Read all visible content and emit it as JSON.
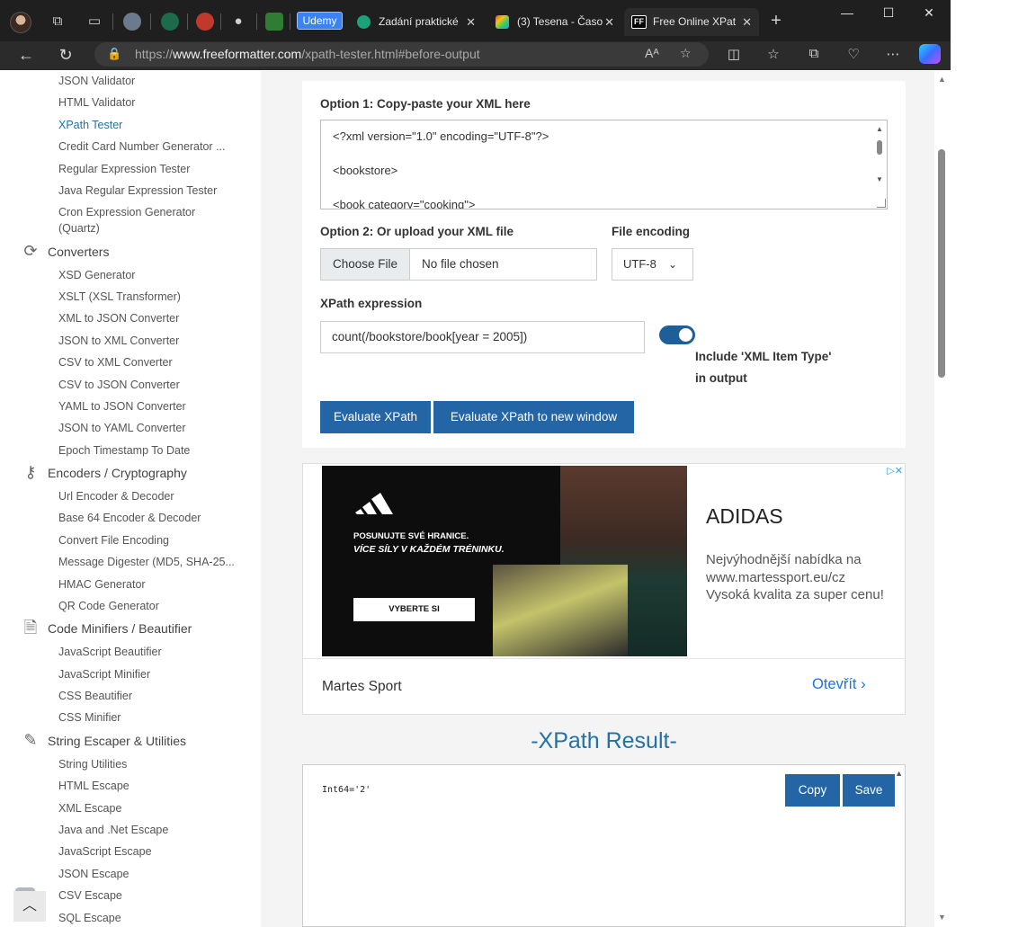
{
  "browser": {
    "tabs": [
      {
        "title": "Zadání praktické",
        "favicon_color": "#1aa37a"
      },
      {
        "title": "(3) Tesena - Časo",
        "favicon_color": "#f0f0f0"
      },
      {
        "title": "Free Online XPat",
        "favicon_color": "#000000"
      }
    ],
    "pinned_badge": "Udemy",
    "url_prefix": "https://",
    "url_host": "www.freeformatter.com",
    "url_path": "/xpath-tester.html#before-output"
  },
  "sidebar": {
    "group_validators": [
      "JSON Validator",
      "HTML Validator",
      "XPath Tester",
      "Credit Card Number Generator ...",
      "Regular Expression Tester",
      "Java Regular Expression Tester",
      "Cron Expression Generator",
      "(Quartz)"
    ],
    "converters_title": "Converters",
    "converters": [
      "XSD Generator",
      "XSLT (XSL Transformer)",
      "XML to JSON Converter",
      "JSON to XML Converter",
      "CSV to XML Converter",
      "CSV to JSON Converter",
      "YAML to JSON Converter",
      "JSON to YAML Converter",
      "Epoch Timestamp To Date"
    ],
    "encoders_title": "Encoders / Cryptography",
    "encoders": [
      "Url Encoder & Decoder",
      "Base 64 Encoder & Decoder",
      "Convert File Encoding",
      "Message Digester (MD5, SHA-25...",
      "HMAC Generator",
      "QR Code Generator"
    ],
    "minifiers_title": "Code Minifiers / Beautifier",
    "minifiers": [
      "JavaScript Beautifier",
      "JavaScript Minifier",
      "CSS Beautifier",
      "CSS Minifier"
    ],
    "escaper_title": "String Escaper & Utilities",
    "escaper": [
      "String Utilities",
      "HTML Escape",
      "XML Escape",
      "Java and .Net Escape",
      "JavaScript Escape",
      "JSON Escape",
      "CSV Escape",
      "SQL Escape"
    ]
  },
  "form": {
    "option1_label": "Option 1: Copy-paste your XML here",
    "xml_lines": [
      "<?xml version=\"1.0\" encoding=\"UTF-8\"?>",
      "<bookstore>",
      "<book category=\"cooking\">"
    ],
    "option2_label": "Option 2: Or upload your XML file",
    "choose_file": "Choose File",
    "no_file": "No file chosen",
    "encoding_label": "File encoding",
    "encoding_value": "UTF-8",
    "xpath_label": "XPath expression",
    "xpath_value": "count(/bookstore/book[year = 2005])",
    "include_label_line1": "Include 'XML Item Type'",
    "include_label_line2": "in output",
    "include_on": true,
    "evaluate_btn": "Evaluate XPath",
    "evaluate_new_btn": "Evaluate XPath to new window"
  },
  "ad": {
    "tagline1": "POSUNUJTE SVÉ HRANICE.",
    "tagline2": "VÍCE SÍLY V KAŽDÉM TRÉNINKU.",
    "cta_img": "VYBERTE SI",
    "title": "ADIDAS",
    "desc": "Nejvýhodnější nabídka na www.martessport.eu/cz Vysoká kvalita za super cenu!",
    "brand": "Martes Sport",
    "open": "Otevřít"
  },
  "result": {
    "title": "-XPath Result-",
    "output": "Int64='2'",
    "copy": "Copy",
    "save": "Save"
  },
  "colors": {
    "accent": "#2465a6",
    "link_active": "#2471a3"
  }
}
